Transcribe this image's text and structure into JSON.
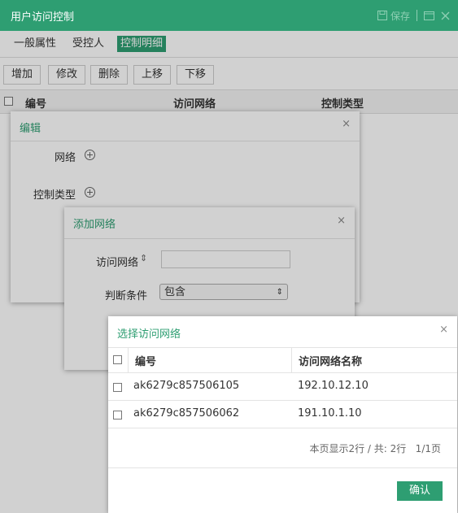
{
  "app": {
    "title": "用户访问控制",
    "save_label": "保存",
    "tabs": [
      "一般属性",
      "受控人",
      "控制明细"
    ]
  },
  "toolbar": {
    "buttons": [
      "增加",
      "修改",
      "删除",
      "上移",
      "下移"
    ]
  },
  "grid": {
    "columns": [
      "编号",
      "访问网络",
      "控制类型"
    ]
  },
  "edit_dialog": {
    "title": "编辑",
    "close": "×",
    "fields": [
      "网络",
      "控制类型"
    ]
  },
  "add_network_dialog": {
    "title": "添加网络",
    "close": "×",
    "network_label": "访问网络",
    "sort_glyph": "⇕",
    "network_value": "",
    "condition_label": "判断条件",
    "condition_value": "包含",
    "select_arrow": "⇕"
  },
  "select_network_dialog": {
    "title": "选择访问网络",
    "close": "×",
    "columns": [
      "编号",
      "访问网络名称"
    ],
    "rows": [
      {
        "id": "ak6279c857506105",
        "name": "192.10.12.10"
      },
      {
        "id": "ak6279c857506062",
        "name": "191.10.1.10"
      }
    ],
    "pagination": "本页显示2行 / 共: 2行   1/1页",
    "confirm_label": "确认"
  },
  "colors": {
    "accent": "#2e9e72"
  }
}
